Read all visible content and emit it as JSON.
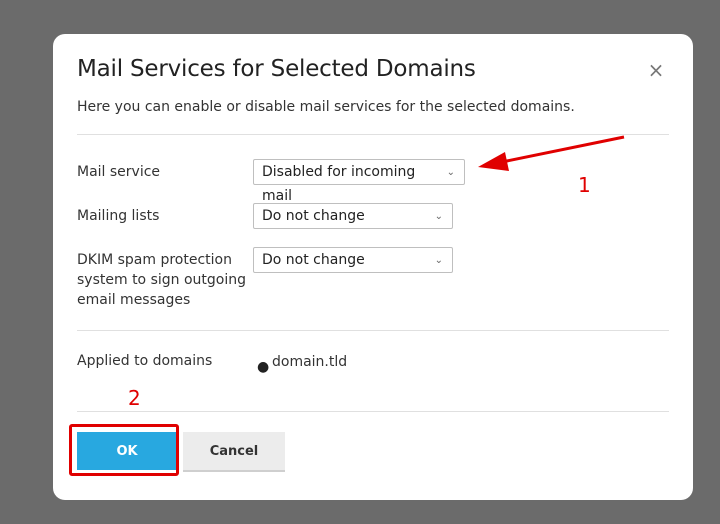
{
  "dialog": {
    "title": "Mail Services for Selected Domains",
    "description": "Here you can enable or disable mail services for the selected domains.",
    "close_icon": "×"
  },
  "fields": [
    {
      "label": "Mail service",
      "value": "Disabled for incoming mail"
    },
    {
      "label": "Mailing lists",
      "value": "Do not change"
    },
    {
      "label": "DKIM spam protection system to sign outgoing email messages",
      "value": "Do not change"
    }
  ],
  "applied": {
    "label": "Applied to domains",
    "domains": [
      "domain.tld"
    ]
  },
  "buttons": {
    "ok": "OK",
    "cancel": "Cancel"
  },
  "annotations": {
    "one": "1",
    "two": "2",
    "color": "#e00000"
  },
  "colors": {
    "overlay": "#6b6b6b",
    "ok_button": "#28a8e0",
    "cancel_button": "#ececec"
  },
  "icons": {
    "close": "close-icon",
    "chevron": "chevron-down-icon"
  }
}
